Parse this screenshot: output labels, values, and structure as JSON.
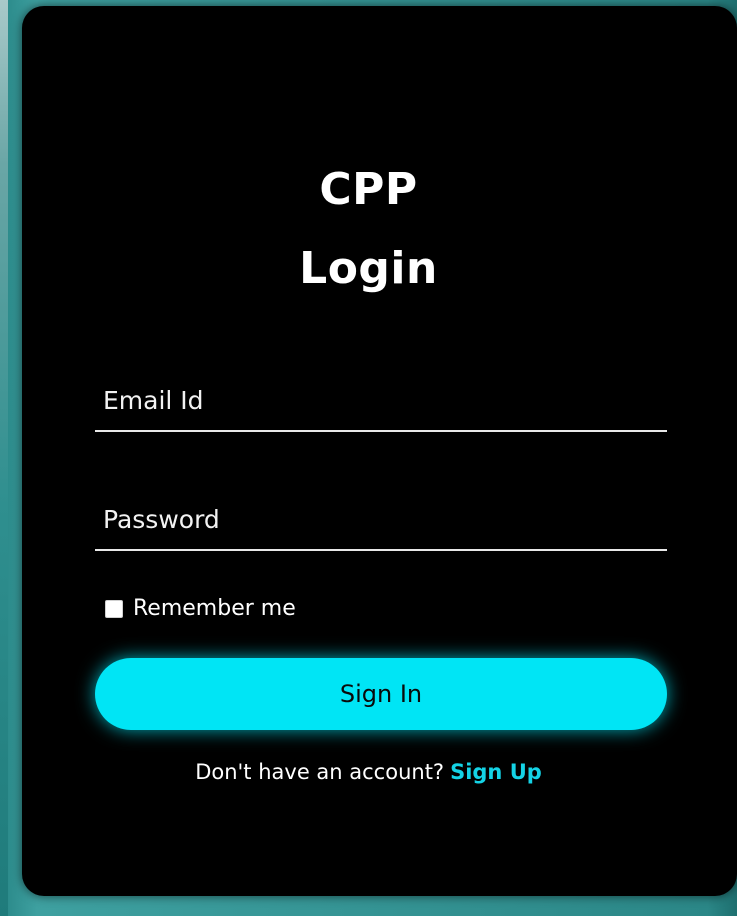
{
  "app": {
    "title": "CPP",
    "heading": "Login"
  },
  "form": {
    "email_placeholder": "Email Id",
    "password_placeholder": "Password",
    "remember_label": "Remember me",
    "remember_checked": false,
    "submit_label": "Sign In"
  },
  "footer": {
    "prompt": "Don't have an account?",
    "link_label": "Sign Up"
  },
  "colors": {
    "card_background": "#000000",
    "accent": "#00e5f5",
    "link": "#14d3e6",
    "outer_background": "#2f8f8f"
  }
}
